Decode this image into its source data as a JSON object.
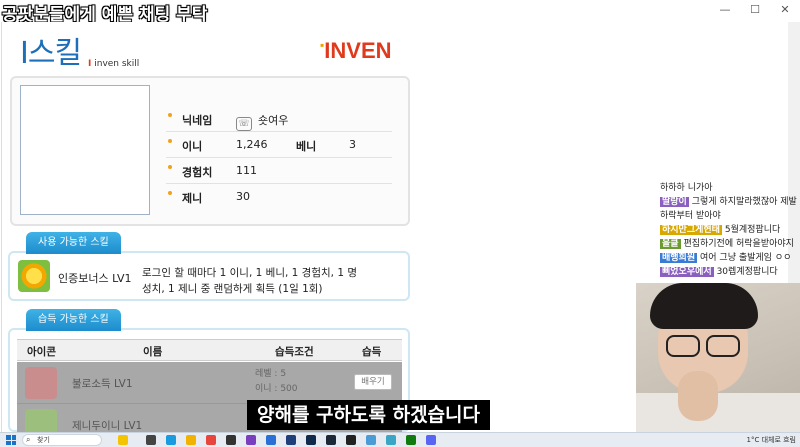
{
  "stream_title": "공팟분들에게 예쁜 채팅 부탁",
  "window_controls": {
    "minimize": "—",
    "maximize": "☐",
    "close": "✕"
  },
  "logo": {
    "skill": "I스킬",
    "sub_brand": "I",
    "sub_text": "inven skill",
    "inven": "INVEN"
  },
  "profile": {
    "nickname_label": "닉네임",
    "nickname_value": "숏여우",
    "inni_label": "이니",
    "inni_value": "1,246",
    "beni_label": "베니",
    "beni_value": "3",
    "exp_label": "경험치",
    "exp_value": "111",
    "zeni_label": "제니",
    "zeni_value": "30"
  },
  "available_skills": {
    "tab_label": "사용 가능한 스킬",
    "skill_name": "인증보너스 LV1",
    "skill_desc": "로그인 할 때마다 1 이니, 1 베니, 1 경험치, 1 명성치, 1 제니 중 랜덤하게 획득 (1일 1회)"
  },
  "learnable_skills": {
    "tab_label": "습득 가능한 스킬",
    "headers": {
      "icon": "아이콘",
      "name": "이름",
      "cond": "습득조건",
      "learn": "습득"
    },
    "rows": [
      {
        "name": "불로소득 LV1",
        "cond_level": "레벨 : 5",
        "cond_inni": "이니 : 500",
        "button": "배우기"
      },
      {
        "name": "제니두이니 LV1",
        "cond_level": "",
        "cond_inni": "",
        "button": ""
      }
    ]
  },
  "chat": [
    {
      "user": "",
      "text": "하하하 니가아",
      "user_color": "plain"
    },
    {
      "user": "딸랑이",
      "text": "그렇게 하지말라했잖아 제발",
      "user_color": "p"
    },
    {
      "user": "",
      "text": "하락부터 받아야",
      "user_color": "plain"
    },
    {
      "user": "하지만그게현태",
      "text": "5월계정팝니다",
      "user_color": "y"
    },
    {
      "user": "올클",
      "text": "편집하기전에 허락을받아야지",
      "user_color": "g"
    },
    {
      "user": "배행희원",
      "text": "여어 그냥 출발게임 ㅇㅇ",
      "user_color": "b"
    },
    {
      "user": "삐었오우에서",
      "text": "30렙계정팝니다",
      "user_color": "p"
    }
  ],
  "subtitle": "양해를 구하도록 하겠습니다",
  "taskbar": {
    "search": "찾기",
    "tray": "1°C 대체로 흐림"
  }
}
